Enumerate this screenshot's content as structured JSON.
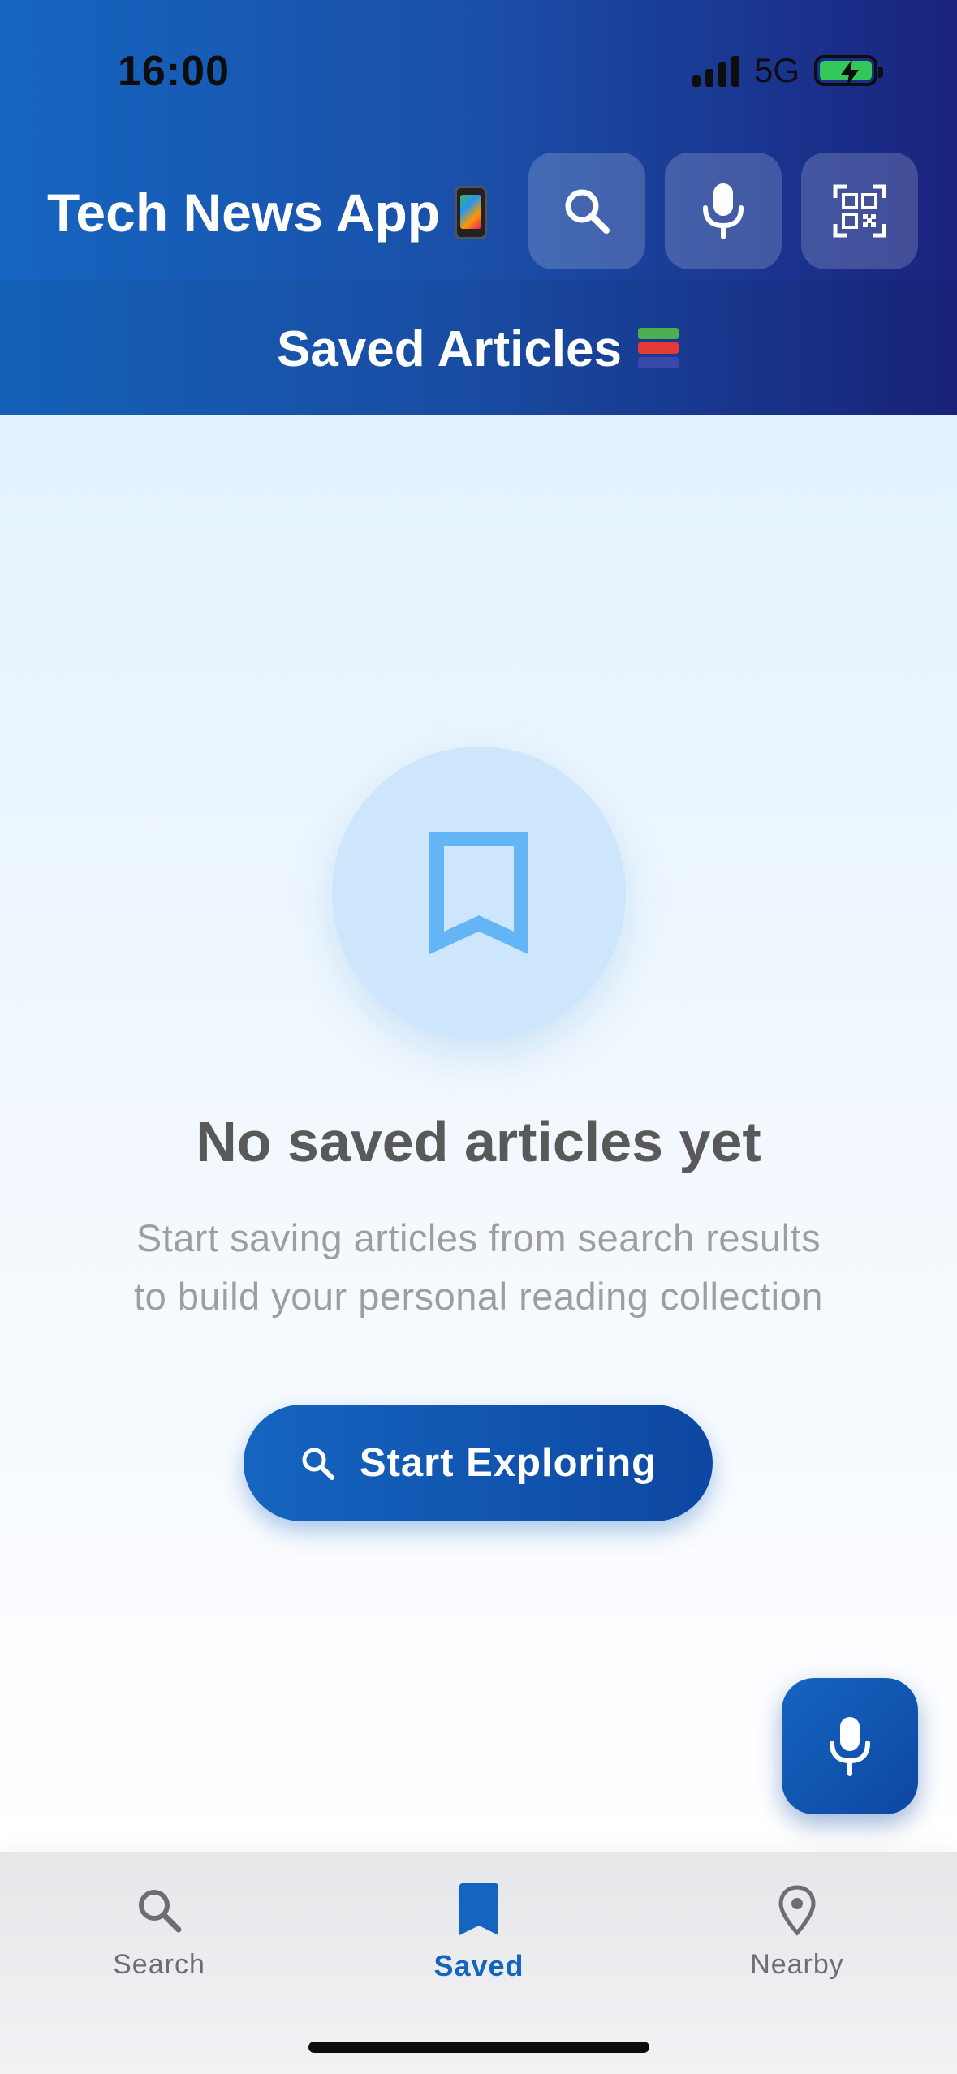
{
  "status_bar": {
    "time": "16:00",
    "network": "5G",
    "battery_state": "charging"
  },
  "header": {
    "app_title": "Tech News App",
    "section_title": "Saved Articles",
    "buttons": [
      {
        "icon": "search-icon"
      },
      {
        "icon": "mic-icon"
      },
      {
        "icon": "qr-scan-icon"
      }
    ]
  },
  "empty_state": {
    "icon": "bookmark-icon",
    "title": "No saved articles yet",
    "description_line1": "Start saving articles from search results",
    "description_line2": "to build your personal reading collection",
    "cta_label": "Start Exploring"
  },
  "fab": {
    "icon": "mic-icon"
  },
  "bottom_nav": {
    "items": [
      {
        "label": "Search",
        "icon": "search-icon",
        "active": false
      },
      {
        "label": "Saved",
        "icon": "bookmark-icon",
        "active": true
      },
      {
        "label": "Nearby",
        "icon": "location-pin-icon",
        "active": false
      }
    ]
  },
  "colors": {
    "primary": "#1565c0",
    "primary_dark": "#0d47a1",
    "header_end": "#1a237e",
    "bookmark_light": "#64b5f6",
    "circle_bg": "#cde6fb",
    "nav_inactive": "#6d6d72"
  }
}
